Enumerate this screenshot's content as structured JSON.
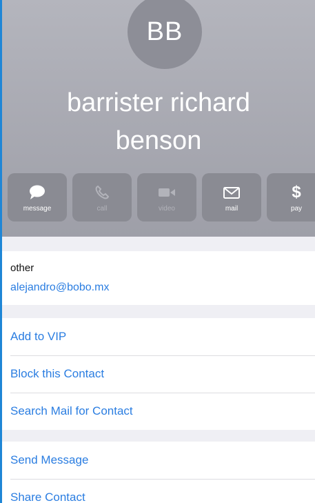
{
  "contact": {
    "initials": "BB",
    "name": "barrister richard benson"
  },
  "actions": [
    {
      "label": "message",
      "icon": "message-bubble-icon",
      "enabled": true
    },
    {
      "label": "call",
      "icon": "phone-icon",
      "enabled": false
    },
    {
      "label": "video",
      "icon": "video-camera-icon",
      "enabled": false
    },
    {
      "label": "mail",
      "icon": "envelope-icon",
      "enabled": true
    },
    {
      "label": "pay",
      "icon": "dollar-icon",
      "enabled": true
    }
  ],
  "email": {
    "label": "other",
    "value": "alejandro@bobo.mx"
  },
  "options": {
    "add_vip": "Add to VIP",
    "block": "Block this Contact",
    "search_mail": "Search Mail for Contact",
    "send_message": "Send Message",
    "share_contact": "Share Contact"
  },
  "colors": {
    "link": "#2a7de1",
    "header": "#a9aab2"
  }
}
